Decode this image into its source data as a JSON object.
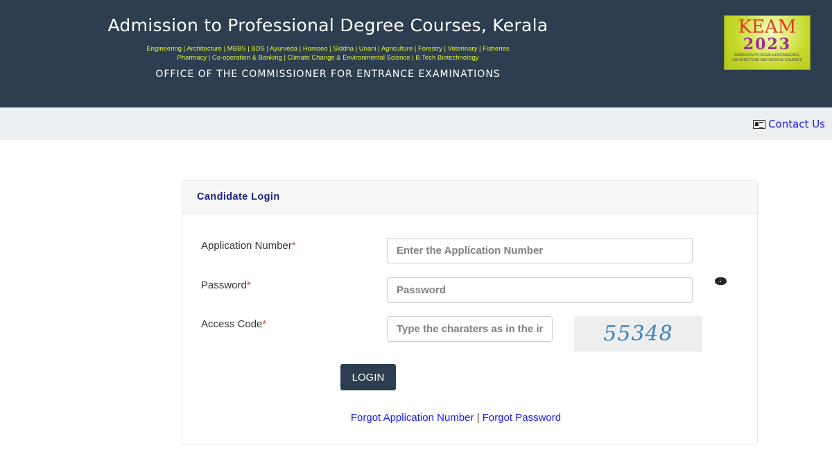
{
  "header": {
    "title": "Admission to Professional Degree Courses, Kerala",
    "courses_line1": "Engineering | Architecture | MBBS | BDS | Ayurveda | Homoeo | Siddha | Unani | Agriculture | Forestry | Veterinary | Fisheries",
    "courses_line2": "Pharmacy | Co-operation & Banking | Climate Change & Environmental Science | B.Tech Biotechnology",
    "office": "OFFICE OF THE COMMISSIONER FOR ENTRANCE EXAMINATIONS",
    "logo": {
      "name": "KEAM",
      "year": "2023",
      "subtitle": "ADMISSION TO KERALA ENGINEERING, ARCHITECTURE AND MEDICAL COURSES"
    }
  },
  "topbar": {
    "contact_label": "Contact Us",
    "contact_icon": "address-card-icon"
  },
  "login": {
    "heading": "Candidate Login",
    "required_mark": "*",
    "application_label": "Application Number",
    "application_placeholder": "Enter the Application Number",
    "application_value": "",
    "password_label": "Password",
    "password_placeholder": "Password",
    "password_value": "",
    "access_label": "Access Code",
    "access_placeholder": "Type the charaters as in the image",
    "access_value": "",
    "captcha_text": "55348",
    "login_button": "LOGIN",
    "forgot_application": "Forgot Application Number",
    "separator": "|",
    "forgot_password": "Forgot Password"
  }
}
